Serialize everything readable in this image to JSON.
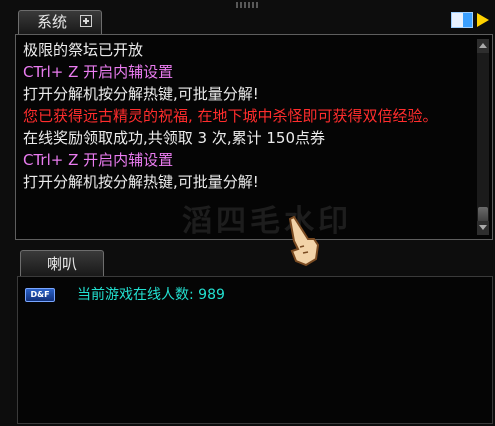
{
  "system_tab": {
    "label": "系统"
  },
  "speaker_tab": {
    "label": "喇叭"
  },
  "messages": [
    {
      "text": "极限的祭坛已开放",
      "color": "white"
    },
    {
      "text": "CTrl+ Z 开启内辅设置",
      "color": "pink"
    },
    {
      "text": "打开分解机按分解热键,可批量分解!",
      "color": "white"
    },
    {
      "text": "您已获得远古精灵的祝福, 在地下城中杀怪即可获得双倍经验。",
      "color": "red"
    },
    {
      "text": "在线奖励领取成功,共领取 3 次,累计 150点券",
      "color": "white"
    },
    {
      "text": "CTrl+ Z 开启内辅设置",
      "color": "pink"
    },
    {
      "text": "打开分解机按分解热键,可批量分解!",
      "color": "white"
    }
  ],
  "speaker": {
    "badge": "D&F",
    "online_text": "当前游戏在线人数: 989"
  },
  "watermark": "滔四毛水印",
  "colors": {
    "white": "#ececec",
    "pink": "#ea7cf0",
    "red": "#ff2d2d",
    "cyan": "#23e0d0"
  },
  "icons": [
    "plus-icon",
    "window-icon",
    "arrow-icon",
    "hand-cursor-icon",
    "df-icon"
  ]
}
